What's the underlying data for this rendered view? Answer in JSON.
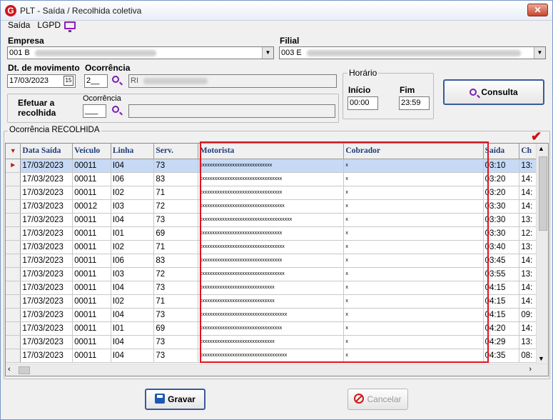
{
  "window": {
    "title": "PLT - Saída / Recolhida coletiva",
    "close_glyph": "✕",
    "logo_letter": "G"
  },
  "menu": {
    "items": [
      "Saída",
      "LGPD"
    ]
  },
  "empresa": {
    "label": "Empresa",
    "value": "001 B"
  },
  "filial": {
    "label": "Filial",
    "value": "003 E"
  },
  "dt_movimento": {
    "label": "Dt. de movimento",
    "value": "17/03/2023",
    "calendar_glyph": "15"
  },
  "ocorrencia": {
    "label": "Ocorrência",
    "value": "2__",
    "desc": "RI"
  },
  "horario": {
    "title": "Horário",
    "inicio_label": "Início",
    "inicio_value": "00:00",
    "fim_label": "Fim",
    "fim_value": "23:59"
  },
  "efetuar": {
    "label_line1": "Efetuar a",
    "label_line2": "recolhida",
    "ocorrencia_label": "Ocorrência",
    "ocorrencia_value": "___"
  },
  "consulta_button": {
    "label": "Consulta"
  },
  "grid": {
    "title": "Ocorrência RECOLHIDA",
    "columns": [
      "Data Saída",
      "Veículo",
      "Linha",
      "Serv.",
      "Motorista",
      "Cobrador",
      "Saída",
      "Ch"
    ],
    "rows": [
      [
        "17/03/2023",
        "00011",
        "I04",
        "73",
        "xxxxxxxxxxxxxxxxxxxxxxxxxxxxx",
        "x",
        "03:10",
        "13:"
      ],
      [
        "17/03/2023",
        "00011",
        "I06",
        "83",
        "xxxxxxxxxxxxxxxxxxxxxxxxxxxxxxxxx",
        "x",
        "03:20",
        "14:"
      ],
      [
        "17/03/2023",
        "00011",
        "I02",
        "71",
        "xxxxxxxxxxxxxxxxxxxxxxxxxxxxxxxxx",
        "x",
        "03:20",
        "14:"
      ],
      [
        "17/03/2023",
        "00012",
        "I03",
        "72",
        "xxxxxxxxxxxxxxxxxxxxxxxxxxxxxxxxxx",
        "x",
        "03:30",
        "14:"
      ],
      [
        "17/03/2023",
        "00011",
        "I04",
        "73",
        "xxxxxxxxxxxxxxxxxxxxxxxxxxxxxxxxxxxxx",
        "x",
        "03:30",
        "13:"
      ],
      [
        "17/03/2023",
        "00011",
        "I01",
        "69",
        "xxxxxxxxxxxxxxxxxxxxxxxxxxxxxxxxx",
        "x",
        "03:30",
        "12:"
      ],
      [
        "17/03/2023",
        "00011",
        "I02",
        "71",
        "xxxxxxxxxxxxxxxxxxxxxxxxxxxxxxxxxx",
        "x",
        "03:40",
        "13:"
      ],
      [
        "17/03/2023",
        "00011",
        "I06",
        "83",
        "xxxxxxxxxxxxxxxxxxxxxxxxxxxxxxxxx",
        "x",
        "03:45",
        "14:"
      ],
      [
        "17/03/2023",
        "00011",
        "I03",
        "72",
        "xxxxxxxxxxxxxxxxxxxxxxxxxxxxxxxxxx",
        "x",
        "03:55",
        "13:"
      ],
      [
        "17/03/2023",
        "00011",
        "I04",
        "73",
        "xxxxxxxxxxxxxxxxxxxxxxxxxxxxxx",
        "x",
        "04:15",
        "14:"
      ],
      [
        "17/03/2023",
        "00011",
        "I02",
        "71",
        "xxxxxxxxxxxxxxxxxxxxxxxxxxxxxx",
        "x",
        "04:15",
        "14:"
      ],
      [
        "17/03/2023",
        "00011",
        "I04",
        "73",
        "xxxxxxxxxxxxxxxxxxxxxxxxxxxxxxxxxxx",
        "x",
        "04:15",
        "09:"
      ],
      [
        "17/03/2023",
        "00011",
        "I01",
        "69",
        "xxxxxxxxxxxxxxxxxxxxxxxxxxxxxxxxx",
        "x",
        "04:20",
        "14:"
      ],
      [
        "17/03/2023",
        "00011",
        "I04",
        "73",
        "xxxxxxxxxxxxxxxxxxxxxxxxxxxxxx",
        "x",
        "04:29",
        "13:"
      ],
      [
        "17/03/2023",
        "00011",
        "I04",
        "73",
        "xxxxxxxxxxxxxxxxxxxxxxxxxxxxxxxxxxx",
        "x",
        "04:35",
        "08:"
      ]
    ]
  },
  "gravar_button": {
    "label": "Gravar"
  },
  "cancelar_button": {
    "label": "Cancelar"
  },
  "colors": {
    "accent_purple": "#7a1fb0",
    "highlight_red": "#e0141e",
    "selected_row": "#c6daf5"
  }
}
